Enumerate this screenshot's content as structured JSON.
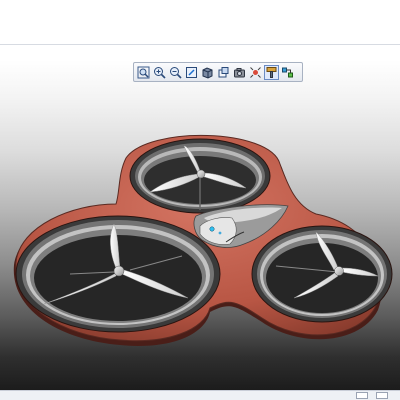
{
  "toolbar": {
    "buttons": [
      {
        "name": "zoom-fit-button",
        "icon": "zoom-fit-icon"
      },
      {
        "name": "zoom-in-button",
        "icon": "zoom-in-icon"
      },
      {
        "name": "zoom-out-button",
        "icon": "zoom-out-icon"
      },
      {
        "name": "view-select-button",
        "icon": "view-select-icon"
      },
      {
        "name": "shading-button",
        "icon": "shaded-cube-icon"
      },
      {
        "name": "view-orientation-button",
        "icon": "view-orientation-icon"
      },
      {
        "name": "camera-button",
        "icon": "camera-icon"
      },
      {
        "name": "hide-show-button",
        "icon": "hide-show-icon"
      },
      {
        "name": "appearance-button",
        "icon": "paint-brush-icon"
      },
      {
        "name": "scene-button",
        "icon": "scene-icon"
      }
    ]
  },
  "colors": {
    "frame": "#c06050",
    "frame_dark": "#5a2a22",
    "ring_metal": "#d8d8d8",
    "blade": "#f2f2f2",
    "toolbar_border": "#a8b2c2"
  }
}
